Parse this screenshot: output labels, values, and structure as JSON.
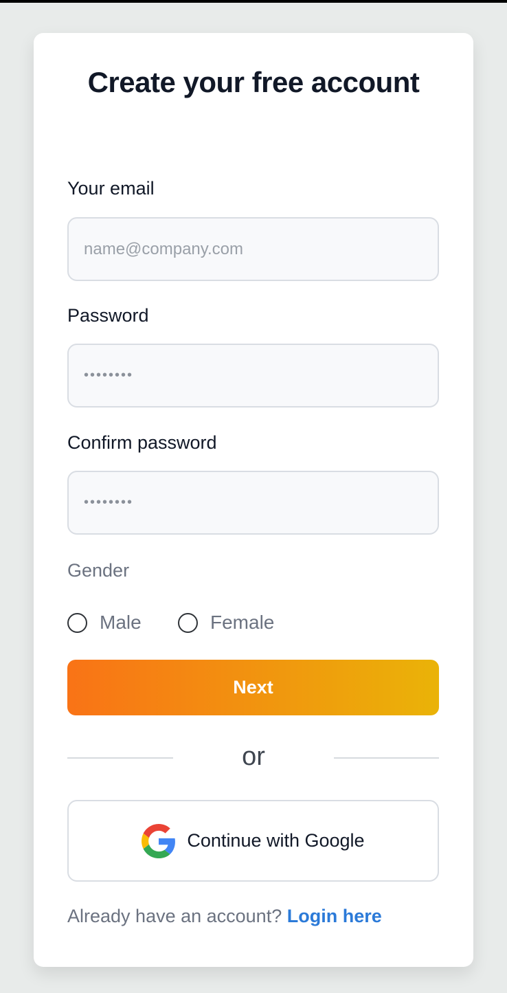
{
  "form": {
    "title": "Create your free account",
    "email": {
      "label": "Your email",
      "placeholder": "name@company.com",
      "value": ""
    },
    "password": {
      "label": "Password",
      "value": "••••••••"
    },
    "confirm_password": {
      "label": "Confirm password",
      "value": "••••••••"
    },
    "gender": {
      "label": "Gender",
      "options": [
        "Male",
        "Female"
      ],
      "selected": null
    },
    "next_label": "Next",
    "divider_text": "or",
    "google_label": "Continue with Google",
    "footer": {
      "prompt": "Already have an account?",
      "link": "Login here"
    }
  },
  "colors": {
    "background": "#e8ebea",
    "card": "#ffffff",
    "gradient_start": "#f97316",
    "gradient_end": "#eab308",
    "link": "#2b7ad8",
    "title": "#111827"
  },
  "icons": {
    "google": "google-g-icon"
  }
}
